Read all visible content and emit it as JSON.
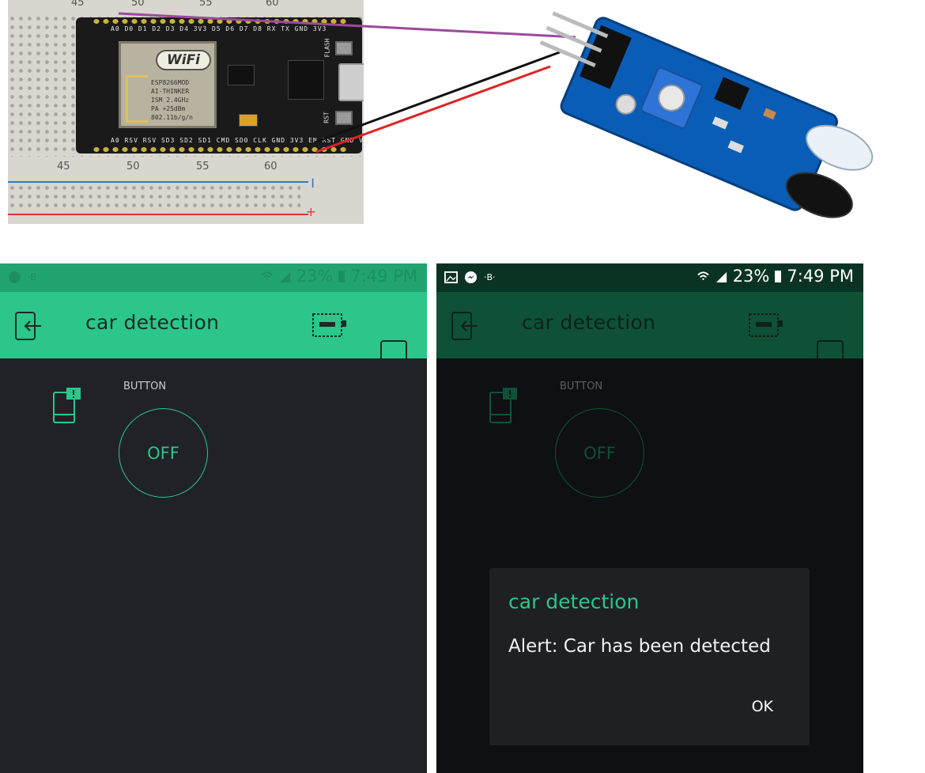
{
  "breadboard": {
    "top_numbers": [
      "45",
      "50",
      "55",
      "60"
    ],
    "bottom_numbers": [
      "45",
      "50",
      "55",
      "60"
    ],
    "rail_minus": "I",
    "rail_plus": "+"
  },
  "mcu": {
    "top_pins": "A0  D0  D1  D2  D3  D4  3V3  D5  D6  D7  D8  RX  TX  GND 3V3",
    "bottom_pins": "A0 RSV RSV SD3 SD2 SD1 CMD SD0 CLK GND 3V3  EN  RST GND Vin",
    "wifi_logo": "WiFi",
    "wifi_text": "ESP8266MOD\nAI-THINKER\nISM 2.4GHz\nPA +25dBm\n802.11b/g/n",
    "flash_label": "FLASH",
    "rst_label": "RST"
  },
  "wires": {
    "colors": [
      "#9b4a9b",
      "#111111",
      "#e02424"
    ]
  },
  "phones": [
    {
      "status": {
        "battery": "23%",
        "time": "7:49 PM"
      },
      "app_title": "car detection",
      "widget_label": "BUTTON",
      "toggle_label": "OFF"
    },
    {
      "status": {
        "indicator": "B",
        "battery": "23%",
        "time": "7:49 PM"
      },
      "app_title": "car detection",
      "widget_label": "BUTTON",
      "toggle_label": "OFF",
      "dialog": {
        "title": "car detection",
        "message": "Alert: Car has been detected",
        "ok_label": "OK"
      }
    }
  ],
  "colors": {
    "accent": "#2cc68a",
    "accent_dark": "#0e5136",
    "canvas_dark": "#212227"
  }
}
